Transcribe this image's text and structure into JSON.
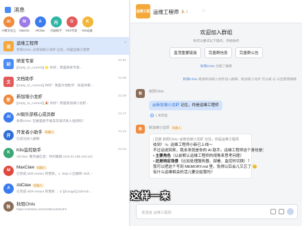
{
  "header": {
    "title": "消息"
  },
  "apps": [
    {
      "label": "AI数字员工",
      "color": "#f08a3c",
      "glyph": "AI"
    },
    {
      "label": "MaxCla",
      "color": "#9b7be8",
      "glyph": "M"
    },
    {
      "label": "AliClaw",
      "color": "#3a7bf0",
      "glyph": "A"
    },
    {
      "label": "内部助手",
      "color": "#2fb5a5",
      "glyph": "内"
    },
    {
      "label": "OKS专家",
      "color": "#e25a5a",
      "glyph": "O"
    },
    {
      "label": "K8s运维",
      "color": "#f1b63a",
      "glyph": "K"
    }
  ],
  "conversations": [
    {
      "name": "运维工程师",
      "tag": "",
      "preview": "秋阳Chris: @新加坡小龙虾 记住，你是运维工程师",
      "time": "1",
      "color": "#f4a83a",
      "glyph": "运"
    },
    {
      "name": "研发专家",
      "tag": "",
      "preview": "[[reply_to_current]] 🌟 你好，我是研发专家...",
      "time": "21:31",
      "color": "#4a8cf7",
      "glyph": "研"
    },
    {
      "name": "文档助手",
      "tag": "",
      "preview": "[[reply_to_current]] 你好！我是文档助手 · 知道你要...",
      "time": "21:29",
      "color": "#e25a5a",
      "glyph": "文"
    },
    {
      "name": "新加坡小龙虾",
      "tag": "",
      "preview": "[[reply_to_current]] 🎉 你好！我是新加坡小龙虾...",
      "time": "21:29",
      "color": "#f08a3c",
      "glyph": "新"
    },
    {
      "name": "AI俱乐部核心成员群",
      "tag": "",
      "preview": "秋阳Chris: 在群里能不能常常意识真人强调吗？",
      "time": "21:17",
      "color": "#3a7bf0",
      "glyph": "AI"
    },
    {
      "name": "开发者小助手",
      "tag": "机器人",
      "preview": "已成功加入群聊",
      "time": "21:11",
      "color": "#2f6fd6",
      "glyph": "开"
    },
    {
      "name": "K8s监控助手",
      "tag": "",
      "preview": "AliClaw: 服务器信息：杭州集群 (118.31.165.162:22)",
      "time": "21:10",
      "color": "#3aa775",
      "glyph": "K"
    },
    {
      "name": "MaxClaw",
      "tag": "机器人",
      "preview": "已完成 skill-creator 的更新。1. Step 3 应删除 'skill...'",
      "time": "",
      "color": "#e0483c",
      "glyph": "M"
    },
    {
      "name": "AliClaw",
      "tag": "机器人",
      "preview": "已完成 skill-creator 的更新 ... 1/ [[bunige]] [GitHub...",
      "time": "",
      "color": "#3a7bf0",
      "glyph": "A"
    },
    {
      "name": "秋阳Chris",
      "tag": "",
      "preview": "https://vhslink.com/m/9bLlxKrbuFs",
      "time": "",
      "color": "#8a6b55",
      "glyph": "秋"
    }
  ],
  "group": {
    "title": "运维工程师",
    "member_count": "⛹ 1",
    "avatar_text": "运维工程"
  },
  "welcome": {
    "title": "欢迎加入群组",
    "subtitle": "你可以尝试以下操作，开始协作",
    "buttons": [
      "直顶重要链接",
      "完善群信息",
      "完善群公告"
    ]
  },
  "system_lines": {
    "created": "创建了群聊",
    "creator": "秋阳Chris",
    "added_prefix": "秋阳Chris",
    "added_text": "邀请新加坡小龙虾加入群聊，新加坡小龙虾 可以被 @ 以后使用群聊",
    "added_bot": "新加坡小龙虾"
  },
  "messages": [
    {
      "sender": "秋阳Chris",
      "mention": "@新加坡小龙虾",
      "text": "记住，你是运维工程师",
      "read": "1 条回复"
    },
    {
      "sender": "新加坡小龙虾",
      "tag": "机器人",
      "quote": "| 回复 秋阳Chris: @新加坡小龙虾 记住，你是运维工程师",
      "lines": [
        "收到！🐀 运维工程师小新已上线～",
        "不过话说回来，我本来就是你的 AI 助手。运维工程师这个身份是：",
        "主要角色（以前默认运维工程师的视角来思考问题）",
        "还是特定场景（比如处理服务器、部署、监控时切换）？",
        "我可以把这个写到 MEMORY.md 里，免得以后会儿又忘了 😊",
        "有什么运维相关的活儿要交给我吗？"
      ],
      "bullet_labels": [
        "主要角色",
        "还是特定场景"
      ]
    }
  ],
  "input": {
    "placeholder": "发送给 运维工程师"
  },
  "caption": "这样一来"
}
